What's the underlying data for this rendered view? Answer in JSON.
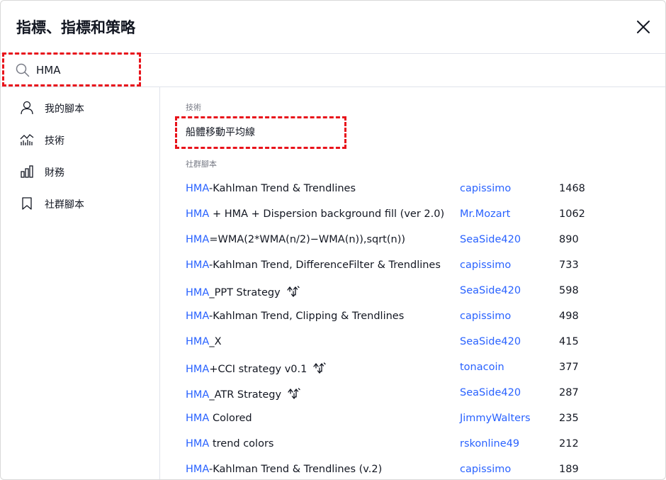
{
  "dialog": {
    "title": "指標、指標和策略"
  },
  "search": {
    "value": "HMA",
    "placeholder": ""
  },
  "sidebar": {
    "items": [
      {
        "label": "我的腳本",
        "icon": "user-icon"
      },
      {
        "label": "技術",
        "icon": "technicals-chart-icon"
      },
      {
        "label": "財務",
        "icon": "financials-bar-chart-icon"
      },
      {
        "label": "社群腳本",
        "icon": "bookmark-icon"
      }
    ]
  },
  "main": {
    "technicals": {
      "section_label": "技術",
      "items": [
        {
          "label": "船體移動平均線"
        }
      ]
    },
    "community": {
      "section_label": "社群腳本",
      "rows": [
        {
          "match": "HMA",
          "rest": "-Kahlman Trend & Trendlines",
          "author": "capissimo",
          "count": "1468",
          "strategy": false
        },
        {
          "match": "HMA",
          "rest": " + HMA + Dispersion background fill (ver 2.0)",
          "author": "Mr.Mozart",
          "count": "1062",
          "strategy": false
        },
        {
          "match": "HMA",
          "rest": "=WMA(2*WMA(n/2)−WMA(n)),sqrt(n))",
          "author": "SeaSide420",
          "count": "890",
          "strategy": false
        },
        {
          "match": "HMA",
          "rest": "-Kahlman Trend, DifferenceFilter & Trendlines",
          "author": "capissimo",
          "count": "733",
          "strategy": false
        },
        {
          "match": "HMA",
          "rest": "_PPT Strategy",
          "author": "SeaSide420",
          "count": "598",
          "strategy": true
        },
        {
          "match": "HMA",
          "rest": "-Kahlman Trend, Clipping & Trendlines",
          "author": "capissimo",
          "count": "498",
          "strategy": false
        },
        {
          "match": "HMA",
          "rest": "_X",
          "author": "SeaSide420",
          "count": "415",
          "strategy": false
        },
        {
          "match": "HMA",
          "rest": "+CCI strategy v0.1",
          "author": "tonacoin",
          "count": "377",
          "strategy": true
        },
        {
          "match": "HMA",
          "rest": "_ATR Strategy",
          "author": "SeaSide420",
          "count": "287",
          "strategy": true
        },
        {
          "match": "HMA",
          "rest": " Colored",
          "author": "JimmyWalters",
          "count": "235",
          "strategy": false
        },
        {
          "match": "HMA",
          "rest": " trend colors",
          "author": "rskonline49",
          "count": "212",
          "strategy": false
        },
        {
          "match": "HMA",
          "rest": "-Kahlman Trend & Trendlines (v.2)",
          "author": "capissimo",
          "count": "189",
          "strategy": false
        }
      ]
    }
  },
  "colors": {
    "accent": "#2962ff",
    "highlight_box": "#e8131b",
    "text": "#131722",
    "muted": "#787b86",
    "divider": "#e0e3eb"
  },
  "icons": {
    "close": "close-icon",
    "search": "search-icon",
    "strategy": "strategy-icon"
  }
}
